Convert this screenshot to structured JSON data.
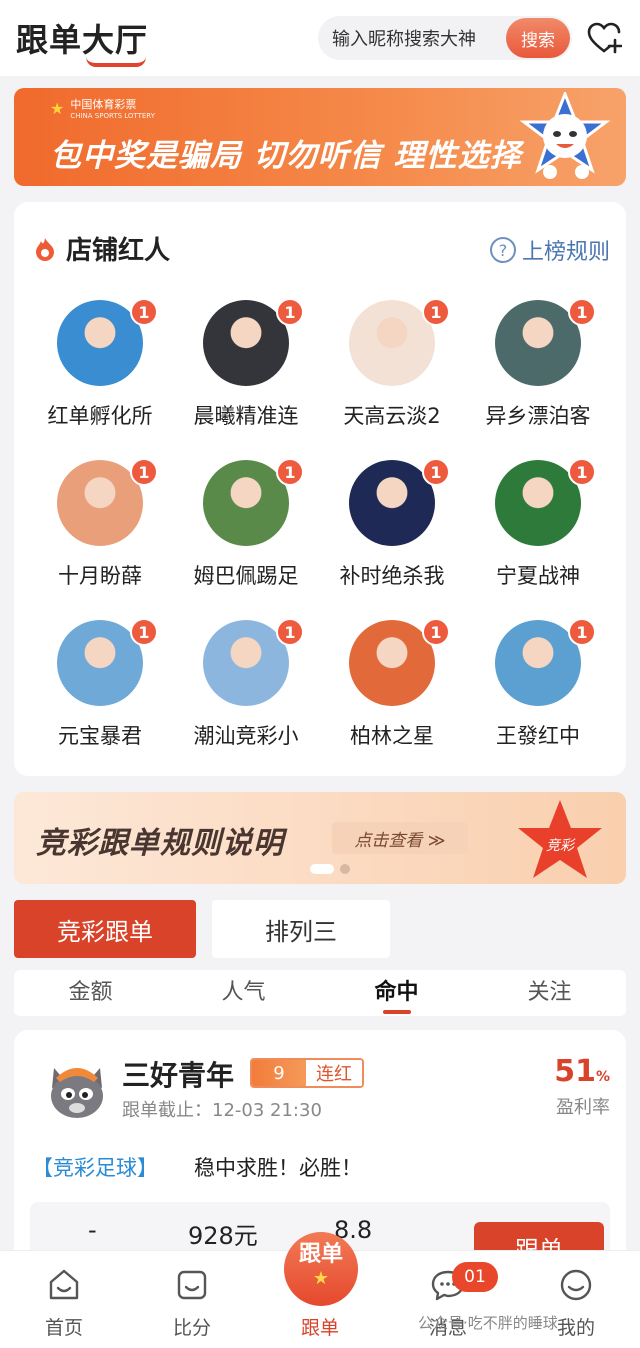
{
  "header": {
    "logo": "跟单大厅",
    "search_placeholder": "输入昵称搜索大神",
    "search_button": "搜索",
    "heart_icon": "heart-plus-icon"
  },
  "banner": {
    "logo_cn": "中国体育彩票",
    "logo_en": "CHINA SPORTS LOTTERY",
    "text": "包中奖是骗局 切勿听信 理性选择"
  },
  "influencers": {
    "title": "店铺红人",
    "rules_label": "上榜规则",
    "items": [
      {
        "name": "红单孵化所",
        "badge": "1",
        "color": "#3a8dd0"
      },
      {
        "name": "晨曦精准连",
        "badge": "1",
        "color": "#33353a"
      },
      {
        "name": "天高云淡2",
        "badge": "1",
        "color": "#f3e1d5"
      },
      {
        "name": "异乡漂泊客",
        "badge": "1",
        "color": "#4c6a6a"
      },
      {
        "name": "十月盼薛",
        "badge": "1",
        "color": "#e9a07a"
      },
      {
        "name": "姆巴佩踢足",
        "badge": "1",
        "color": "#5a8a4a"
      },
      {
        "name": "补时绝杀我",
        "badge": "1",
        "color": "#1e2a55"
      },
      {
        "name": "宁夏战神",
        "badge": "1",
        "color": "#2e7a3a"
      },
      {
        "name": "元宝暴君",
        "badge": "1",
        "color": "#6fa9d8"
      },
      {
        "name": "潮汕竞彩小",
        "badge": "1",
        "color": "#8db6de"
      },
      {
        "name": "柏林之星",
        "badge": "1",
        "color": "#e26a3a"
      },
      {
        "name": "王發红中",
        "badge": "1",
        "color": "#5ba0d0"
      }
    ]
  },
  "banner2": {
    "text": "竞彩跟单规则说明",
    "button": "点击查看 ≫",
    "star_label": "竞彩"
  },
  "tabs": {
    "main": "竞彩跟单",
    "alt": "排列三"
  },
  "sort": [
    "金额",
    "人气",
    "命中",
    "关注"
  ],
  "sort_active": "命中",
  "follow_card": {
    "name": "三好青年",
    "streak_num": "9",
    "streak_label": "连红",
    "deadline": "跟单截止：12-03 21:30",
    "rate_value": "51",
    "rate_unit": "%",
    "rate_label": "盈利率",
    "tag": "【竞彩足球】",
    "slogan": "稳中求胜！必胜！",
    "stat1": "-",
    "stat2": "928元",
    "stat3": "8.8",
    "button": "跟单"
  },
  "nav": {
    "items": [
      {
        "label": "首页",
        "icon": "home-icon"
      },
      {
        "label": "比分",
        "icon": "score-icon"
      },
      {
        "label": "跟单",
        "icon": "follow-icon"
      },
      {
        "label": "消息",
        "icon": "message-icon"
      },
      {
        "label": "我的",
        "icon": "profile-icon"
      }
    ],
    "center_label": "跟单",
    "message_badge": "01"
  },
  "watermark": "公众号·吃不胖的睡球"
}
